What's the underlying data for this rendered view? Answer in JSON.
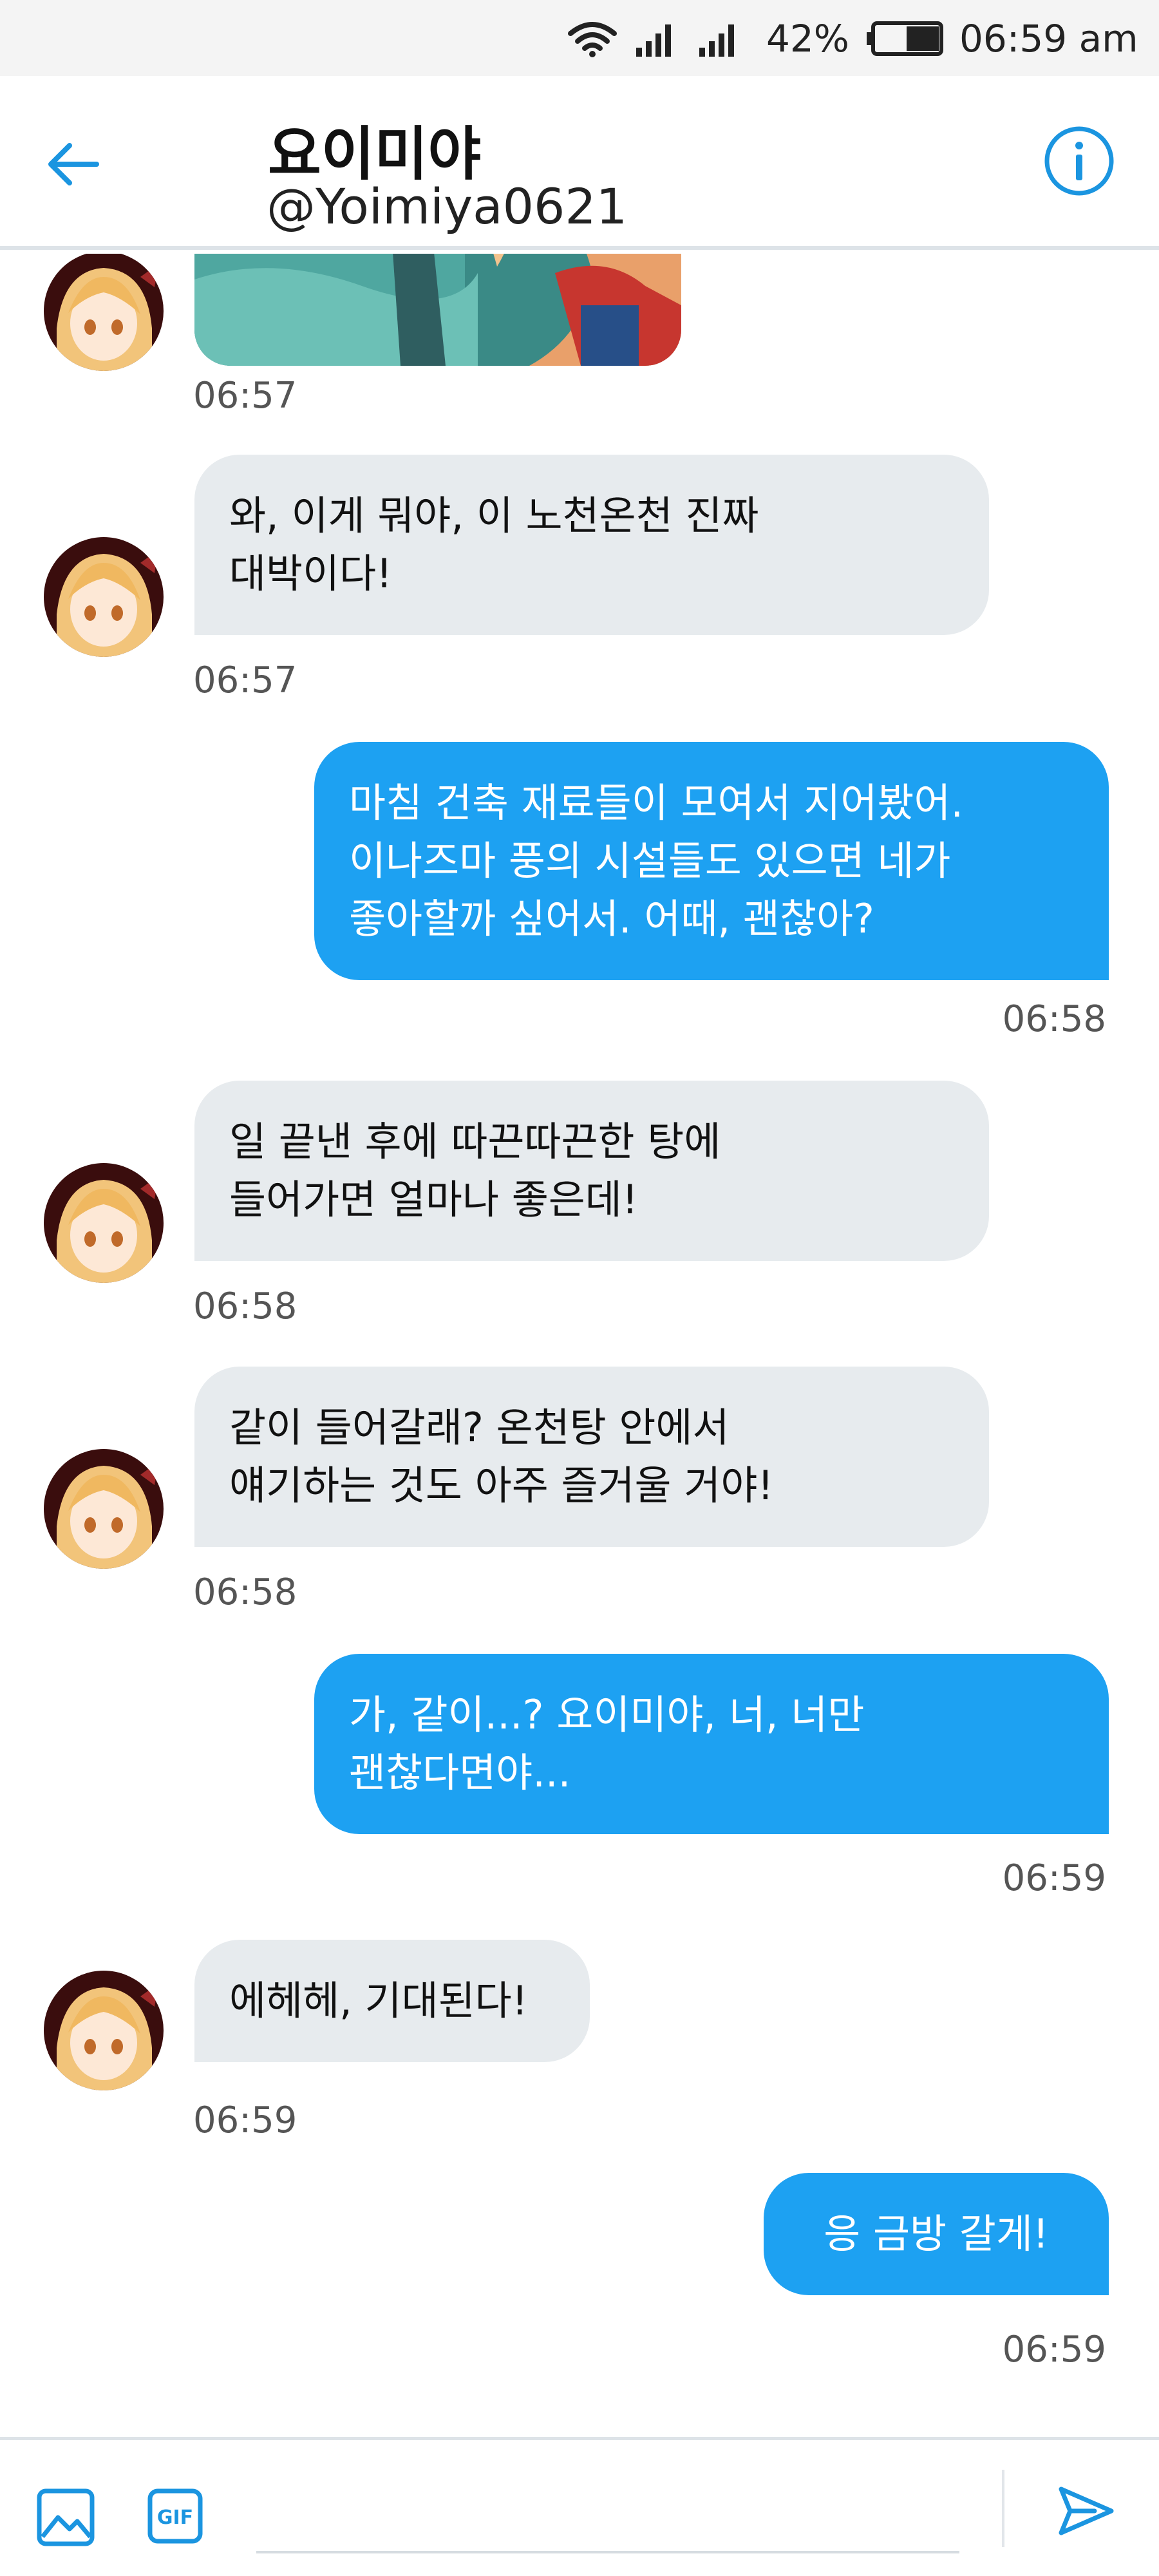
{
  "status_bar": {
    "battery_percent": "42%",
    "time": "06:59 am"
  },
  "header": {
    "name": "요이미야",
    "handle": "@Yoimiya0621"
  },
  "colors": {
    "accent": "#1da1f2",
    "incoming_bubble": "#e7ebee",
    "header_icon": "#1b95e0"
  },
  "icons": {
    "back": "arrow-left-icon",
    "info": "info-circle-icon",
    "image": "image-icon",
    "gif": "gif-icon",
    "send": "send-icon"
  },
  "messages": [
    {
      "direction": "in",
      "type": "image",
      "time": "06:57"
    },
    {
      "direction": "in",
      "text": "와, 이게 뭐야, 이 노천온천 진짜\n대박이다!",
      "time": "06:57"
    },
    {
      "direction": "out",
      "text": "마침 건축 재료들이 모여서 지어봤어.\n이나즈마 풍의 시설들도 있으면 네가\n좋아할까 싶어서. 어때, 괜찮아?",
      "time": "06:58"
    },
    {
      "direction": "in",
      "text": "일 끝낸 후에 따끈따끈한 탕에\n들어가면 얼마나 좋은데!",
      "time": "06:58"
    },
    {
      "direction": "in",
      "text": "같이 들어갈래? 온천탕 안에서\n얘기하는 것도 아주 즐거울 거야!",
      "time": "06:58"
    },
    {
      "direction": "out",
      "text": "가, 같이...? 요이미야, 너, 너만\n괜찮다면야...",
      "time": "06:59"
    },
    {
      "direction": "in",
      "text": "에헤헤, 기대된다!",
      "time": "06:59"
    },
    {
      "direction": "out",
      "text": "응 금방 갈게!",
      "time": "06:59"
    }
  ],
  "composer": {
    "placeholder": ""
  }
}
